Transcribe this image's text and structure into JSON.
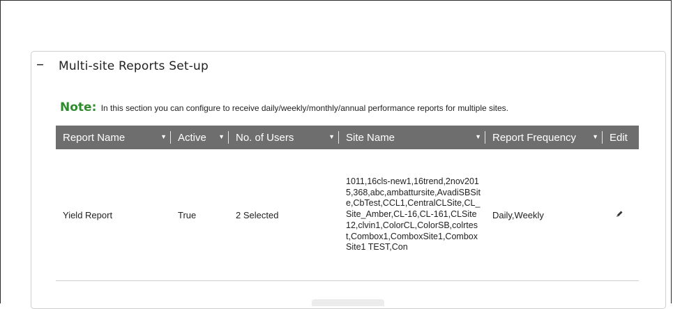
{
  "section": {
    "toggle_symbol": "–",
    "title": "Multi-site Reports Set-up"
  },
  "note": {
    "label": "Note:",
    "text": "In this section you can configure to receive daily/weekly/monthly/annual performance reports for multiple sites."
  },
  "table": {
    "sort_glyph": "▼",
    "columns": [
      "Report Name",
      "Active",
      "No. of Users",
      "Site Name",
      "Report Frequency",
      "Edit"
    ],
    "rows": [
      {
        "report_name": "Yield Report",
        "active": "True",
        "users": "2 Selected",
        "site_name": "1011,16cls-new1,16trend,2nov2015,368,abc,ambattursite,AvadiSBSite,CbTest,CCL1,CentralCLSite,CL_Site_Amber,CL-16,CL-161,CLSite12,clvin1,ColorCL,ColorSB,colrtest,Combox1,ComboxSite1,ComboxSite1 TEST,Con",
        "frequency": "Daily,Weekly",
        "edit_icon": "pencil-icon"
      }
    ]
  },
  "colors": {
    "header_bg": "#6e6e6e",
    "note_green": "#2e8b2e"
  }
}
